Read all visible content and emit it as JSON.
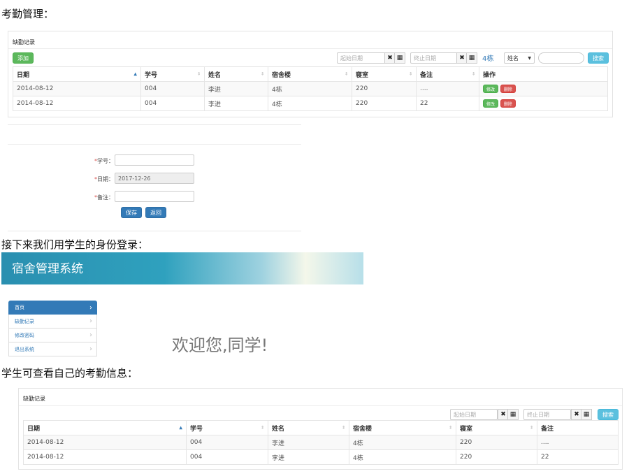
{
  "section1": {
    "heading": "考勤管理："
  },
  "admin_panel": {
    "title": "缺勤记录",
    "add_label": "添加",
    "start_date_placeholder": "起始日期",
    "end_date_placeholder": "终止日期",
    "clear_glyph": "✖",
    "calendar_glyph": "▦",
    "building_label": "4栋",
    "select_value": "姓名",
    "search_label": "搜索",
    "headers": [
      "日期",
      "学号",
      "姓名",
      "宿舍楼",
      "寝室",
      "备注",
      "操作"
    ],
    "rows": [
      {
        "date": "2014-08-12",
        "sid": "004",
        "name": "李进",
        "building": "4栋",
        "room": "220",
        "note": "....",
        "edit": "修改",
        "delete": "删除"
      },
      {
        "date": "2014-08-12",
        "sid": "004",
        "name": "李进",
        "building": "4栋",
        "room": "220",
        "note": "22",
        "edit": "修改",
        "delete": "删除"
      }
    ]
  },
  "form": {
    "sid_label": "学号：",
    "date_label": "日期：",
    "date_value": "2017-12-26",
    "note_label": "备注：",
    "required_mark": "*",
    "save_label": "保存",
    "back_label": "返回"
  },
  "section2": {
    "heading": "接下来我们用学生的身份登录："
  },
  "student_portal": {
    "banner_title": "宿舍管理系统",
    "menu": [
      {
        "label": "首页",
        "active": true
      },
      {
        "label": "缺勤记录",
        "active": false
      },
      {
        "label": "修改密码",
        "active": false
      },
      {
        "label": "退出系统",
        "active": false
      }
    ],
    "chevron": "›",
    "welcome": "欢迎您,同学!"
  },
  "section3": {
    "heading": "学生可查看自己的考勤信息："
  },
  "student_panel": {
    "title": "缺勤记录",
    "start_date_placeholder": "起始日期",
    "end_date_placeholder": "终止日期",
    "search_label": "搜索",
    "headers": [
      "日期",
      "学号",
      "姓名",
      "宿舍楼",
      "寝室",
      "备注"
    ],
    "rows": [
      {
        "date": "2014-08-12",
        "sid": "004",
        "name": "李进",
        "building": "4栋",
        "room": "220",
        "note": "...."
      },
      {
        "date": "2014-08-12",
        "sid": "004",
        "name": "李进",
        "building": "4栋",
        "room": "220",
        "note": "22"
      }
    ]
  },
  "colors": {
    "primary": "#337ab7",
    "success": "#5cb85c",
    "danger": "#d9534f",
    "info": "#5bc0de"
  }
}
